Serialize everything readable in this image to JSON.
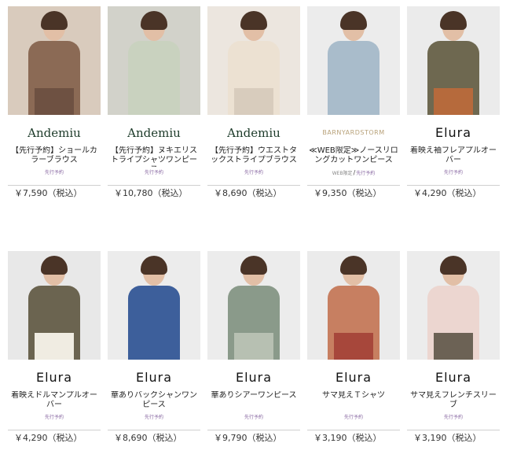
{
  "products": [
    {
      "brand": "Andemiu",
      "brand_style": "andemiu",
      "title": "【先行予約】ショールカラーブラウス",
      "tags": [
        "先行予約"
      ],
      "price": "￥7,590（税込）",
      "colors": {
        "bg": "#d9cbbd",
        "body": "#8b6a55",
        "lower": "#6e5142"
      }
    },
    {
      "brand": "Andemiu",
      "brand_style": "andemiu",
      "title": "【先行予約】ヌキエリストライプシャツワンピース",
      "tags": [
        "先行予約"
      ],
      "price": "￥10,780（税込）",
      "colors": {
        "bg": "#d2d2ca",
        "body": "#c9d2bf",
        "lower": "#c9d2bf"
      }
    },
    {
      "brand": "Andemiu",
      "brand_style": "andemiu",
      "title": "【先行予約】ウエストタックストライプブラウス",
      "tags": [
        "先行予約"
      ],
      "price": "￥8,690（税込）",
      "colors": {
        "bg": "#ece6df",
        "body": "#ece1d2",
        "lower": "#d8ccbd"
      }
    },
    {
      "brand": "BARNYARDSTORM",
      "brand_style": "barn",
      "title": "≪WEB限定≫ノースリロングカットワンピース",
      "tags": [
        "WEB限定",
        "先行予約"
      ],
      "price": "￥9,350（税込）",
      "colors": {
        "bg": "#ececec",
        "body": "#a9bccb",
        "lower": "#a9bccb"
      }
    },
    {
      "brand": "Elura",
      "brand_style": "elura",
      "title": "着映え袖フレアプルオーバー",
      "tags": [
        "先行予約"
      ],
      "price": "￥4,290（税込）",
      "colors": {
        "bg": "#ebebeb",
        "body": "#6e6850",
        "lower": "#b66a3c"
      }
    },
    {
      "brand": "Elura",
      "brand_style": "elura",
      "title": "着映えドルマンプルオーバー",
      "tags": [
        "先行予約"
      ],
      "price": "￥4,290（税込）",
      "colors": {
        "bg": "#e8e8e8",
        "body": "#6b6450",
        "lower": "#f0ece2"
      }
    },
    {
      "brand": "Elura",
      "brand_style": "elura",
      "title": "華ありバックシャンワンピース",
      "tags": [
        "先行予約"
      ],
      "price": "￥8,690（税込）",
      "colors": {
        "bg": "#ececec",
        "body": "#3d5f9b",
        "lower": "#3d5f9b"
      }
    },
    {
      "brand": "Elura",
      "brand_style": "elura",
      "title": "華ありシアーワンピース",
      "tags": [
        "先行予約"
      ],
      "price": "￥9,790（税込）",
      "colors": {
        "bg": "#ececec",
        "body": "#8a9a8a",
        "lower": "#b7c0b2"
      }
    },
    {
      "brand": "Elura",
      "brand_style": "elura",
      "title": "サマ見えＴシャツ",
      "tags": [
        "先行予約"
      ],
      "price": "￥3,190（税込）",
      "colors": {
        "bg": "#ebebeb",
        "body": "#c77f61",
        "lower": "#a7473b"
      }
    },
    {
      "brand": "Elura",
      "brand_style": "elura",
      "title": "サマ見えフレンチスリーブ",
      "tags": [
        "先行予約"
      ],
      "price": "￥3,190（税込）",
      "colors": {
        "bg": "#ececec",
        "body": "#ecd6d0",
        "lower": "#6c6255"
      }
    }
  ]
}
